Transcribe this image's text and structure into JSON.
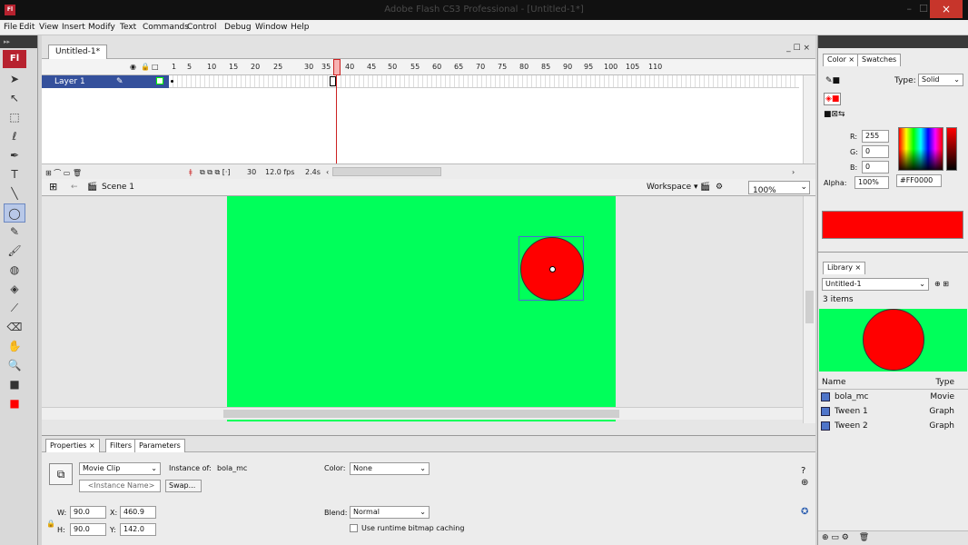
{
  "window": {
    "title": "Adobe Flash CS3 Professional - [Untitled-1*]",
    "badge": "Fl",
    "minimize": "–",
    "maximize": "☐",
    "close": "×"
  },
  "menu": [
    "File",
    "Edit",
    "View",
    "Insert",
    "Modify",
    "Text",
    "Commands",
    "Control",
    "Debug",
    "Window",
    "Help"
  ],
  "toolbox": {
    "logo": "Fl",
    "tools": [
      "arrow-icon",
      "subselect-icon",
      "free-transform-icon",
      "lasso-icon",
      "pen-icon",
      "text-icon",
      "line-icon",
      "oval-icon",
      "pencil-icon",
      "brush-icon",
      "ink-bottle-icon",
      "paint-bucket-icon",
      "eyedropper-icon",
      "eraser-icon",
      "hand-icon",
      "zoom-icon",
      "stroke-color-icon",
      "fill-color-icon"
    ]
  },
  "document": {
    "tab": "Untitled-1*",
    "panel_ctrl": "_ ☐ ×"
  },
  "timeline": {
    "frame_numbers": [
      "1",
      "5",
      "10",
      "15",
      "20",
      "25",
      "30",
      "35",
      "40",
      "45",
      "50",
      "55",
      "60",
      "65",
      "70",
      "75",
      "80",
      "85",
      "90",
      "95",
      "100",
      "105",
      "110"
    ],
    "layer_name": "Layer 1",
    "current_frame": "30",
    "fps": "12.0 fps",
    "elapsed": "2.4s"
  },
  "editbar": {
    "scene": "Scene 1",
    "workspace": "Workspace ▾",
    "zoom": "100%"
  },
  "properties": {
    "tabs": [
      "Properties ×",
      "Filters",
      "Parameters"
    ],
    "symbol_type": "Movie Clip",
    "instance_of_label": "Instance of:",
    "instance_of": "bola_mc",
    "instance_name_placeholder": "<Instance Name>",
    "swap": "Swap...",
    "color_label": "Color:",
    "color_value": "None",
    "blend_label": "Blend:",
    "blend_value": "Normal",
    "bitmap_caching": "Use runtime bitmap caching",
    "w_label": "W:",
    "w": "90.0",
    "h_label": "H:",
    "h": "90.0",
    "x_label": "X:",
    "x": "460.9",
    "y_label": "Y:",
    "y": "142.0"
  },
  "color_panel": {
    "tabs": [
      "Color ×",
      "Swatches"
    ],
    "type_label": "Type:",
    "type_value": "Solid",
    "r_label": "R:",
    "r": "255",
    "g_label": "G:",
    "g": "0",
    "b_label": "B:",
    "b": "0",
    "alpha_label": "Alpha:",
    "alpha": "100%",
    "hex": "#FF0000"
  },
  "library": {
    "tab": "Library ×",
    "doc": "Untitled-1",
    "count": "3 items",
    "col_name": "Name",
    "col_type": "Type",
    "items": [
      {
        "name": "bola_mc",
        "type": "Movie"
      },
      {
        "name": "Tween 1",
        "type": "Graph"
      },
      {
        "name": "Tween 2",
        "type": "Graph"
      }
    ]
  }
}
